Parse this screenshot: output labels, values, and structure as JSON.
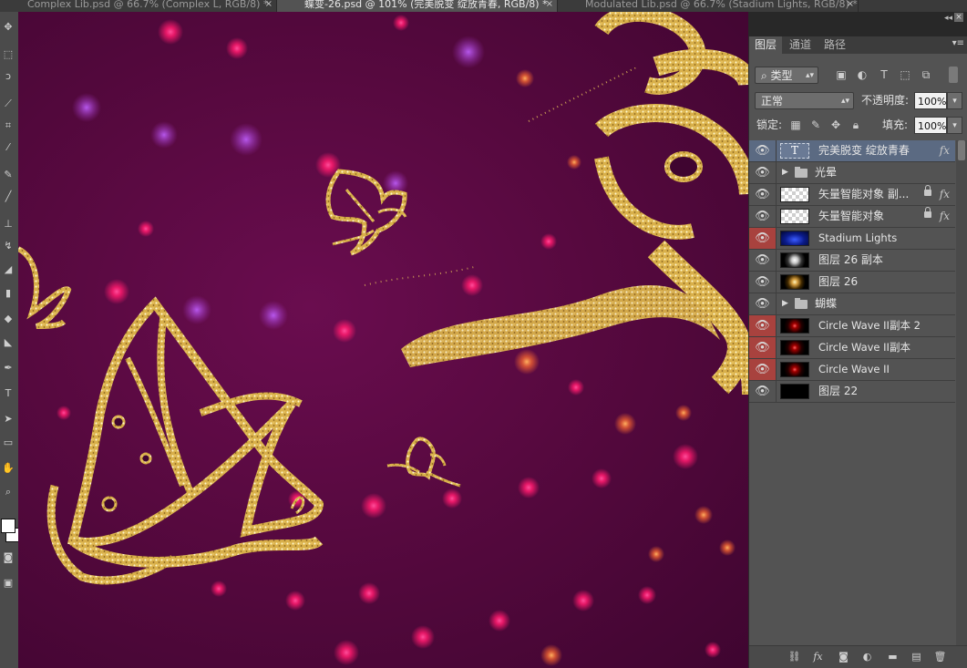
{
  "doc_tabs": [
    {
      "label": "Complex Lib.psd @ 66.7% (Complex L, RGB/8) *",
      "active": false
    },
    {
      "label": "蝶变-26.psd @ 101% (完美脱变 绽放青春, RGB/8) *",
      "active": true
    },
    {
      "label": "Modulated Lib.psd @ 66.7% (Stadium Lights, RGB/8) *",
      "active": false
    }
  ],
  "close_glyph": "×",
  "panel": {
    "tabs": [
      "图层",
      "通道",
      "路径"
    ],
    "filter_kind": "类型",
    "blend_mode": "正常",
    "opacity_label": "不透明度:",
    "opacity_value": "100%",
    "lock_label": "锁定:",
    "fill_label": "填充:",
    "fill_value": "100%",
    "fx_label": "fx",
    "text_thumb": "T"
  },
  "layers": [
    {
      "name": "完美脱变 绽放青春",
      "kind": "text",
      "eye_red": false,
      "fx": true,
      "selected": true
    },
    {
      "name": "光晕",
      "kind": "group",
      "eye_red": false
    },
    {
      "name": "矢量智能对象 副...",
      "kind": "smart",
      "eye_red": false,
      "fx": true,
      "locked": true
    },
    {
      "name": "矢量智能对象",
      "kind": "smart",
      "eye_red": false,
      "fx": true,
      "locked": true
    },
    {
      "name": "Stadium Lights",
      "kind": "blue",
      "eye_red": true
    },
    {
      "name": "图层 26 副本",
      "kind": "flare",
      "eye_red": false
    },
    {
      "name": "图层 26",
      "kind": "flare",
      "eye_red": false
    },
    {
      "name": "蝴蝶",
      "kind": "group",
      "eye_red": false
    },
    {
      "name": "Circle Wave II副本 2",
      "kind": "red",
      "eye_red": true
    },
    {
      "name": "Circle Wave II副本",
      "kind": "red",
      "eye_red": true
    },
    {
      "name": "Circle Wave II",
      "kind": "red",
      "eye_red": true
    },
    {
      "name": "图层 22",
      "kind": "black",
      "eye_red": false
    }
  ],
  "colors": {
    "eye_red": "#a8423e",
    "selected_row": "#5b6a82",
    "gold": "#e8c45a",
    "canvas_bg": "#57093f",
    "bokeh": "#ff1a6e"
  },
  "icons": [
    "move-icon",
    "marquee-icon",
    "lasso-icon",
    "quick-select-icon",
    "crop-icon",
    "eyedropper-icon",
    "healing-icon",
    "brush-icon",
    "stamp-icon",
    "history-brush-icon",
    "eraser-icon",
    "gradient-icon",
    "blur-icon",
    "dodge-icon",
    "pen-icon",
    "type-icon",
    "path-select-icon",
    "shape-icon",
    "hand-icon",
    "zoom-icon"
  ]
}
